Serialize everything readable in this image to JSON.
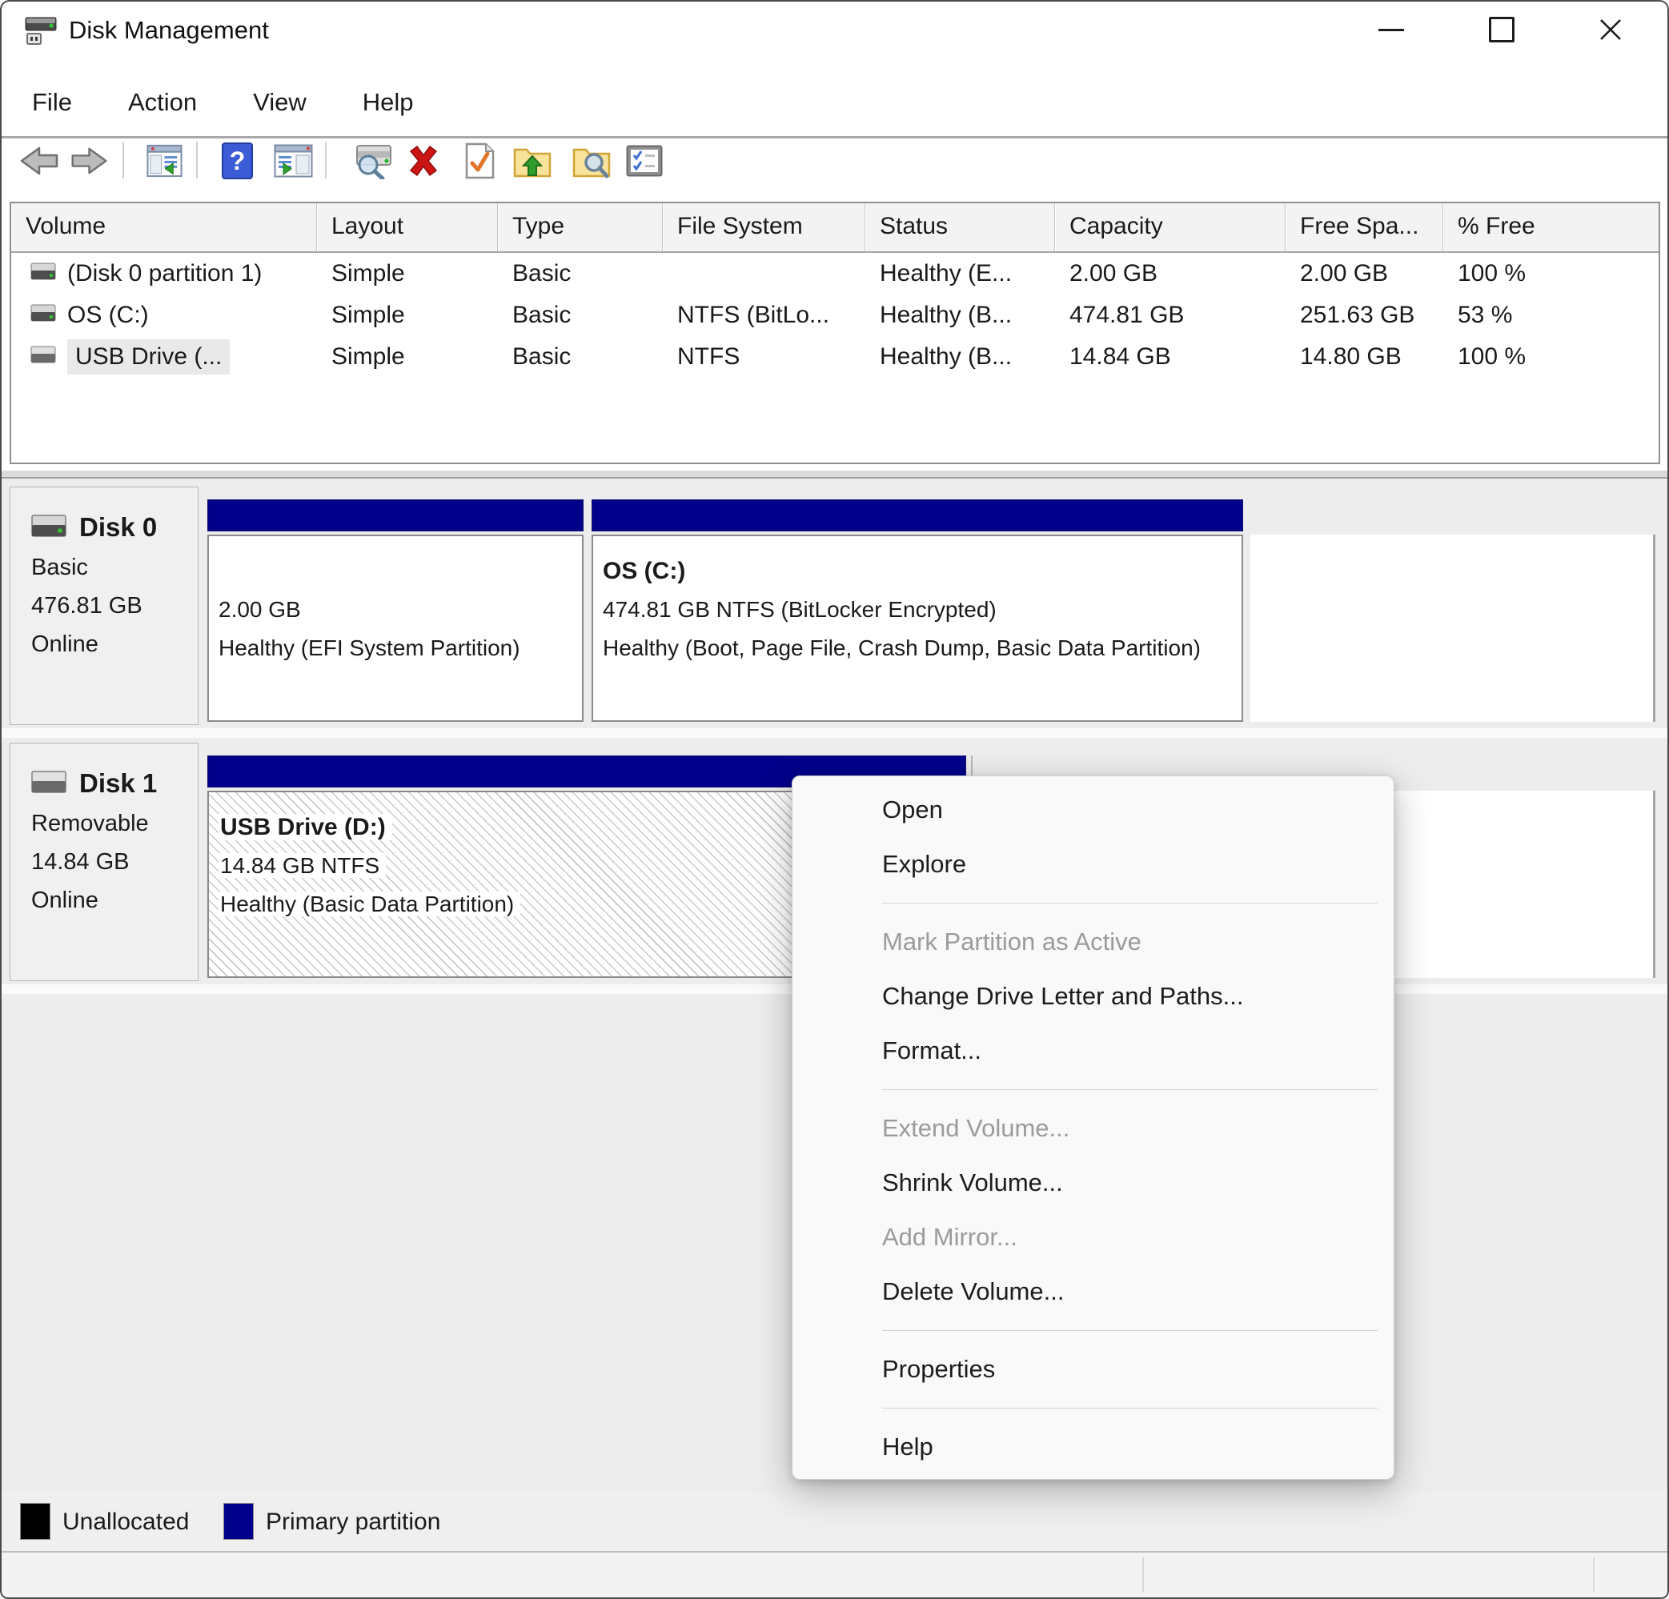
{
  "window": {
    "title": "Disk Management"
  },
  "menu_bar": {
    "items": [
      "File",
      "Action",
      "View",
      "Help"
    ]
  },
  "toolbar": {
    "icons": [
      "back",
      "forward",
      "show-console-tree",
      "help",
      "show-action-pane",
      "rescan-disks",
      "delete",
      "check-file-system",
      "open-folder-up",
      "explore-folder",
      "properties-list"
    ]
  },
  "volume_list": {
    "columns": [
      "Volume",
      "Layout",
      "Type",
      "File System",
      "Status",
      "Capacity",
      "Free Spa...",
      "% Free"
    ],
    "rows": [
      {
        "volume": "(Disk 0 partition 1)",
        "layout": "Simple",
        "type": "Basic",
        "file_system": "",
        "status": "Healthy (E...",
        "capacity": "2.00 GB",
        "free_space": "2.00 GB",
        "pct_free": "100 %"
      },
      {
        "volume": "OS (C:)",
        "layout": "Simple",
        "type": "Basic",
        "file_system": "NTFS (BitLo...",
        "status": "Healthy (B...",
        "capacity": "474.81 GB",
        "free_space": "251.63 GB",
        "pct_free": "53 %"
      },
      {
        "volume": "USB Drive (...",
        "layout": "Simple",
        "type": "Basic",
        "file_system": "NTFS",
        "status": "Healthy (B...",
        "capacity": "14.84 GB",
        "free_space": "14.80 GB",
        "pct_free": "100 %"
      }
    ]
  },
  "disks": [
    {
      "name": "Disk 0",
      "type": "Basic",
      "size": "476.81 GB",
      "status": "Online",
      "partitions": [
        {
          "label": "",
          "size_line": "2.00 GB",
          "status_line": "Healthy (EFI System Partition)"
        },
        {
          "label": "OS  (C:)",
          "size_line": "474.81 GB NTFS (BitLocker Encrypted)",
          "status_line": "Healthy (Boot, Page File, Crash Dump, Basic Data Partition)"
        }
      ]
    },
    {
      "name": "Disk 1",
      "type": "Removable",
      "size": "14.84 GB",
      "status": "Online",
      "partitions": [
        {
          "label": "USB Drive  (D:)",
          "size_line": "14.84 GB NTFS",
          "status_line": "Healthy (Basic Data Partition)"
        }
      ]
    }
  ],
  "context_menu": {
    "items": [
      {
        "label": "Open",
        "enabled": true
      },
      {
        "label": "Explore",
        "enabled": true
      },
      {
        "type": "separator"
      },
      {
        "label": "Mark Partition as Active",
        "enabled": false
      },
      {
        "label": "Change Drive Letter and Paths...",
        "enabled": true
      },
      {
        "label": "Format...",
        "enabled": true
      },
      {
        "type": "separator"
      },
      {
        "label": "Extend Volume...",
        "enabled": false
      },
      {
        "label": "Shrink Volume...",
        "enabled": true
      },
      {
        "label": "Add Mirror...",
        "enabled": false
      },
      {
        "label": "Delete Volume...",
        "enabled": true
      },
      {
        "type": "separator"
      },
      {
        "label": "Properties",
        "enabled": true
      },
      {
        "type": "separator"
      },
      {
        "label": "Help",
        "enabled": true
      }
    ]
  },
  "legend": {
    "items": [
      {
        "label": "Unallocated",
        "color": "#000000"
      },
      {
        "label": "Primary partition",
        "color": "#00008b"
      }
    ]
  },
  "colors": {
    "partition_header": "#00008b",
    "selection_hatch": "#c9c9c9"
  }
}
